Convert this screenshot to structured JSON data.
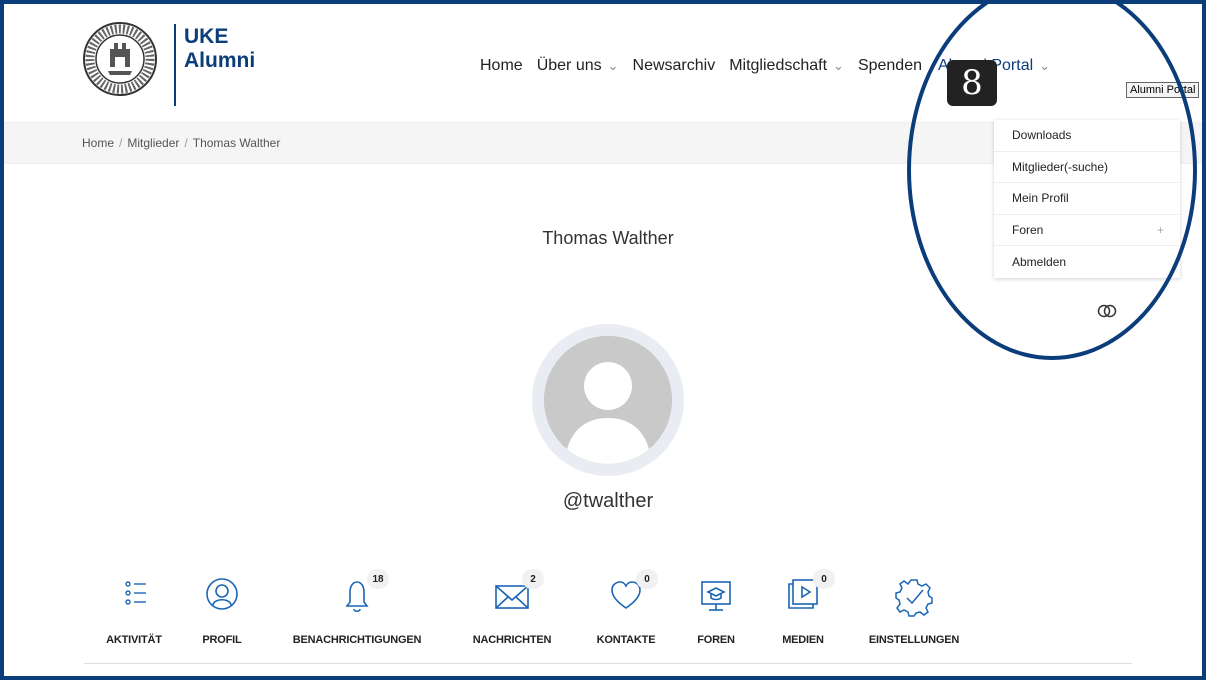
{
  "brand": {
    "line1": "UKE",
    "line2": "Alumni"
  },
  "nav": {
    "items": [
      {
        "label": "Home",
        "has_dropdown": false
      },
      {
        "label": "Über uns",
        "has_dropdown": true
      },
      {
        "label": "Newsarchiv",
        "has_dropdown": false
      },
      {
        "label": "Mitgliedschaft",
        "has_dropdown": true
      },
      {
        "label": "Spenden",
        "has_dropdown": false
      },
      {
        "label": "Alumni Portal",
        "has_dropdown": true
      }
    ],
    "tooltip": "Alumni Portal"
  },
  "breadcrumb": [
    "Home",
    "Mitglieder",
    "Thomas Walther"
  ],
  "dropdown": {
    "items": [
      {
        "label": "Downloads"
      },
      {
        "label": "Mitglieder(-suche)"
      },
      {
        "label": "Mein Profil"
      },
      {
        "label": "Foren",
        "expand": "+"
      },
      {
        "label": "Abmelden"
      }
    ]
  },
  "annotation": {
    "step": "8"
  },
  "profile": {
    "name": "Thomas Walther",
    "handle": "@twalther"
  },
  "tabs": [
    {
      "label": "AKTIVITÄT",
      "count": null,
      "icon": "list-icon"
    },
    {
      "label": "PROFIL",
      "count": null,
      "icon": "profile-icon"
    },
    {
      "label": "BENACHRICHTIGUNGEN",
      "count": "18",
      "icon": "bell-icon"
    },
    {
      "label": "NACHRICHTEN",
      "count": "2",
      "icon": "envelope-icon"
    },
    {
      "label": "KONTAKTE",
      "count": "0",
      "icon": "heart-icon"
    },
    {
      "label": "FOREN",
      "count": null,
      "icon": "forum-icon"
    },
    {
      "label": "MEDIEN",
      "count": "0",
      "icon": "media-icon"
    },
    {
      "label": "EINSTELLUNGEN",
      "count": null,
      "icon": "settings-gear-icon"
    }
  ],
  "colors": {
    "brand": "#0b3d7a",
    "text": "#222222",
    "muted": "#555555"
  }
}
